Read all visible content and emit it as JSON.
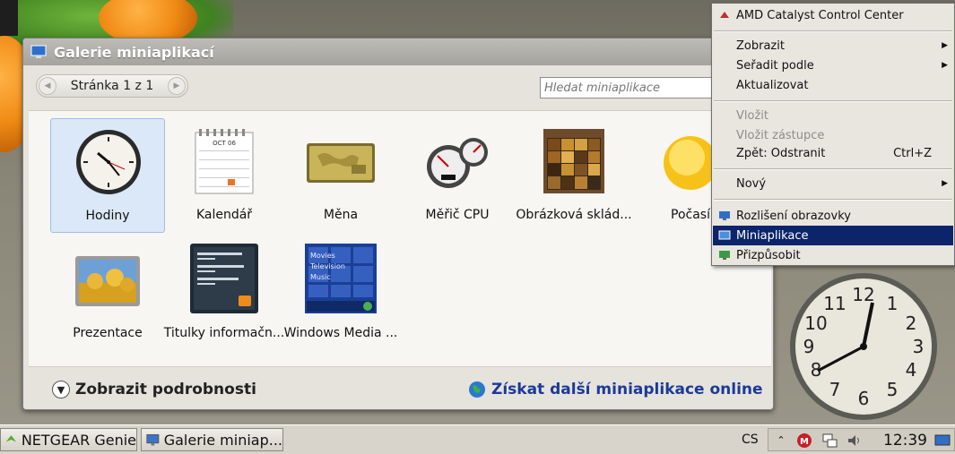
{
  "gallery": {
    "title": "Galerie miniaplikací",
    "pager_text": "Stránka 1 z 1",
    "search_placeholder": "Hledat miniaplikace",
    "details_label": "Zobrazit podrobnosti",
    "online_label": "Získat další miniaplikace online",
    "gadgets": [
      {
        "label": "Hodiny",
        "icon": "clock-icon"
      },
      {
        "label": "Kalendář",
        "icon": "calendar-icon",
        "month": "OCT 06"
      },
      {
        "label": "Měna",
        "icon": "currency-icon"
      },
      {
        "label": "Měřič CPU",
        "icon": "cpu-meter-icon"
      },
      {
        "label": "Obrázková sklád...",
        "icon": "picture-puzzle-icon"
      },
      {
        "label": "Počasí",
        "icon": "weather-sun-icon"
      },
      {
        "label": "Prezentace",
        "icon": "slideshow-icon"
      },
      {
        "label": "Titulky informačn...",
        "icon": "feed-headlines-icon"
      },
      {
        "label": "Windows Media ...",
        "icon": "windows-media-center-icon",
        "menu": [
          "Movies",
          "Television",
          "Music"
        ]
      }
    ]
  },
  "context_menu": {
    "items": [
      {
        "label": "AMD Catalyst Control Center",
        "icon": "amd-icon"
      },
      {
        "label": "Zobrazit",
        "submenu": true
      },
      {
        "label": "Seřadit podle",
        "submenu": true
      },
      {
        "label": "Aktualizovat"
      },
      {
        "label": "Vložit",
        "disabled": true
      },
      {
        "label": "Vložit zástupce",
        "disabled": true
      },
      {
        "label": "Zpět: Odstranit",
        "shortcut": "Ctrl+Z"
      },
      {
        "label": "Nový",
        "submenu": true
      },
      {
        "label": "Rozlišení obrazovky",
        "icon": "display-icon"
      },
      {
        "label": "Miniaplikace",
        "icon": "gadgets-icon",
        "highlighted": true
      },
      {
        "label": "Přizpůsobit",
        "icon": "personalize-icon"
      }
    ]
  },
  "taskbar": {
    "buttons": [
      {
        "label": "NETGEAR Genie",
        "icon": "netgear-icon"
      },
      {
        "label": "Galerie miniap...",
        "icon": "gadget-gallery-icon"
      }
    ],
    "language": "CS",
    "clock": "12:39"
  },
  "colors": {
    "menu_highlight": "#0b246a",
    "online_link": "#1b3a9a",
    "selected_tile": "#dbe8f7"
  }
}
